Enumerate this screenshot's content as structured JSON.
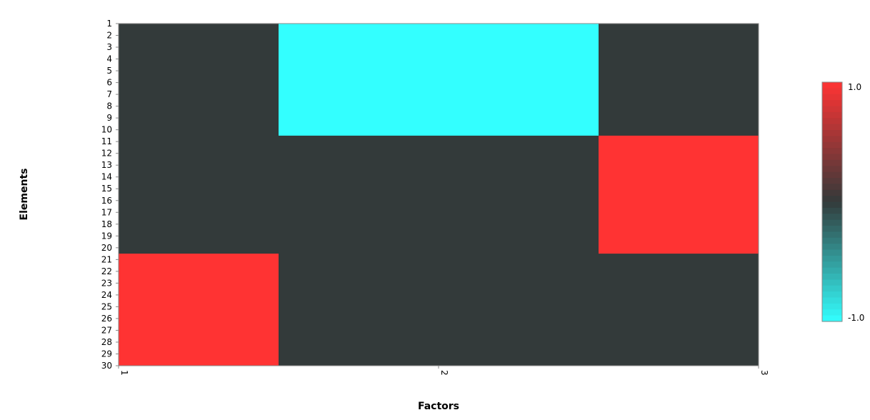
{
  "chart_data": {
    "type": "heatmap",
    "title": "",
    "xlabel": "Factors",
    "ylabel": "Elements",
    "x_categories": [
      "1",
      "2",
      "3"
    ],
    "y_categories": [
      "1",
      "2",
      "3",
      "4",
      "5",
      "6",
      "7",
      "8",
      "9",
      "10",
      "11",
      "12",
      "13",
      "14",
      "15",
      "16",
      "17",
      "18",
      "19",
      "20",
      "21",
      "22",
      "23",
      "24",
      "25",
      "26",
      "27",
      "28",
      "29",
      "30"
    ],
    "x_range": [
      1,
      3
    ],
    "y_range": [
      1,
      30
    ],
    "blocks": [
      {
        "x_from": 1.5,
        "x_to": 2.5,
        "y_from": 1,
        "y_to": 10.5,
        "value": -1.0
      },
      {
        "x_from": 2.5,
        "x_to": 3,
        "y_from": 10.5,
        "y_to": 20.5,
        "value": 1.0
      },
      {
        "x_from": 1,
        "x_to": 1.5,
        "y_from": 20.5,
        "y_to": 30,
        "value": 1.0
      }
    ],
    "background_value": 0.0,
    "colorbar": {
      "min": -1.0,
      "max": 1.0,
      "min_label": "-1.0",
      "max_label": "1.0",
      "colors": {
        "low": "#33ffff",
        "mid": "#333a3a",
        "high": "#ff3333"
      }
    },
    "grid": false,
    "legend_position": "right"
  }
}
